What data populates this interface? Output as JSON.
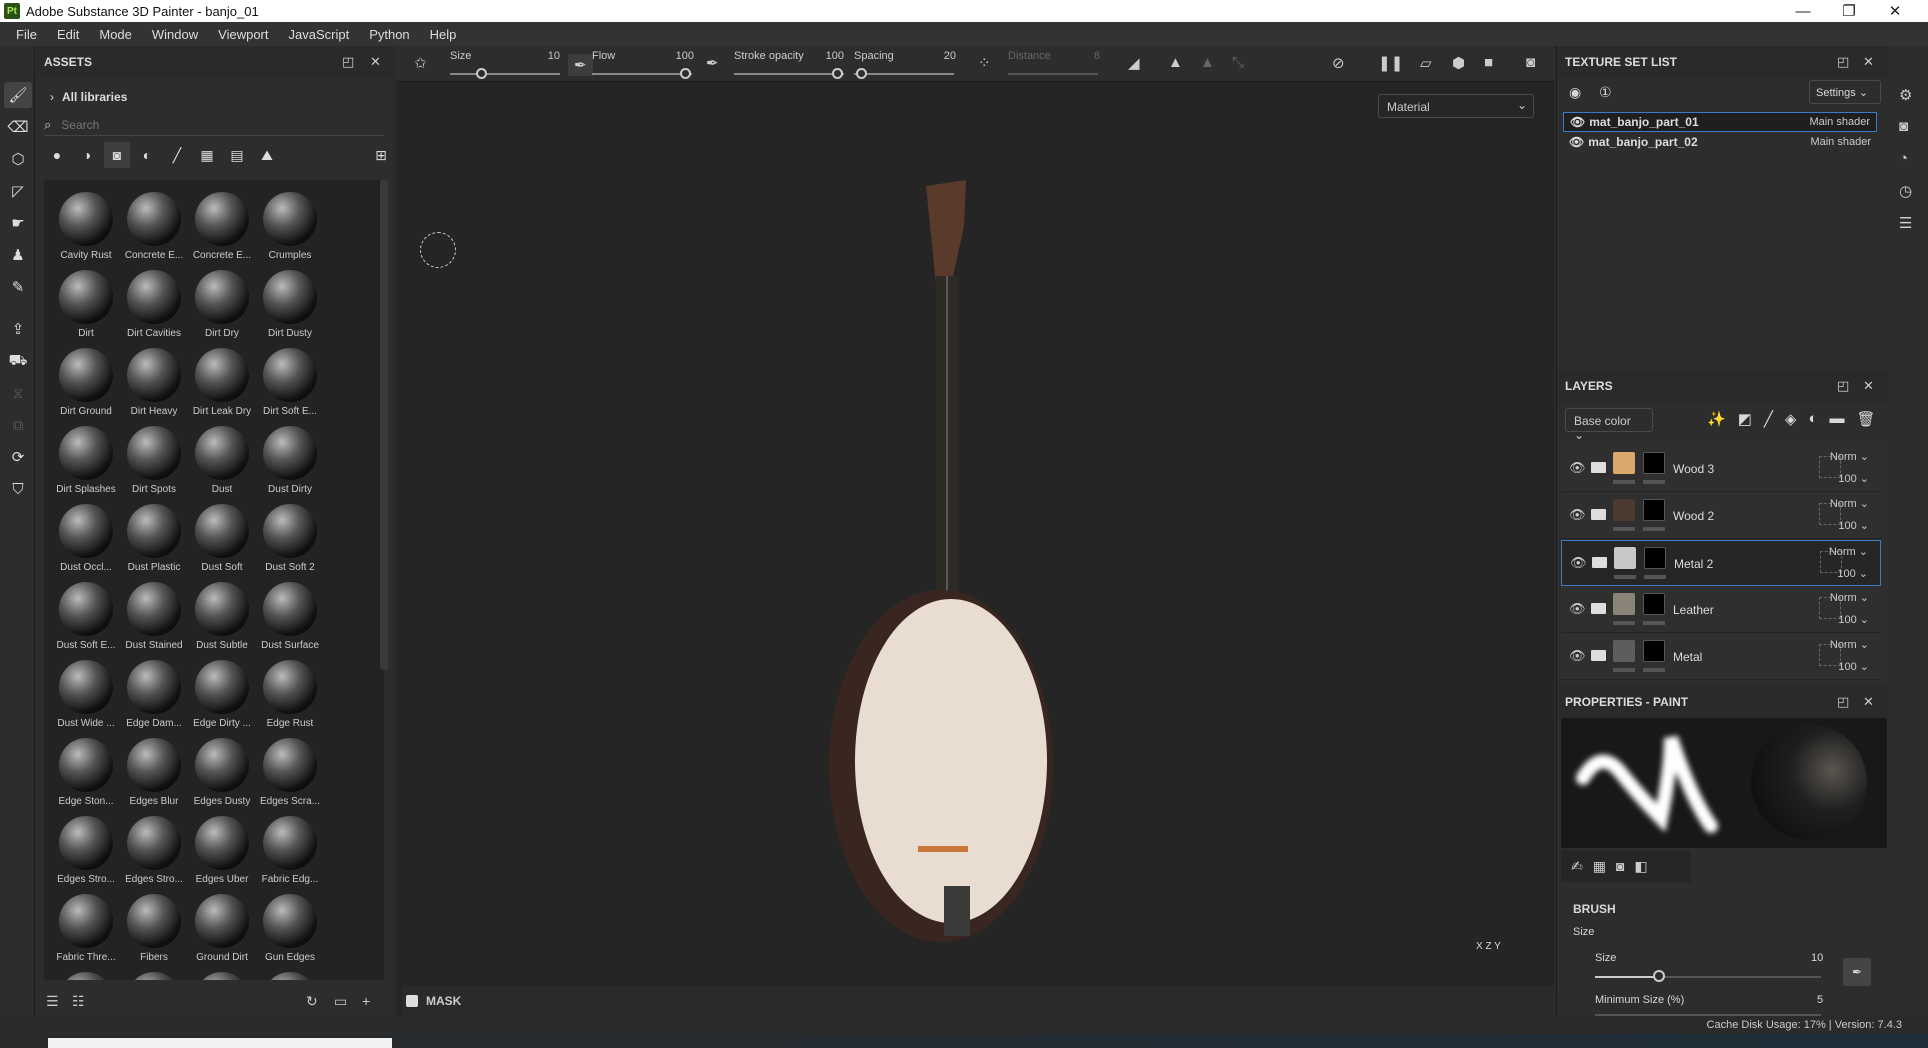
{
  "window": {
    "title": "Adobe Substance 3D Painter - banjo_01",
    "app_badge": "Pt",
    "minimize": "—",
    "restore": "❐",
    "close": "✕"
  },
  "menu": [
    "File",
    "Edit",
    "Mode",
    "Window",
    "Viewport",
    "JavaScript",
    "Python",
    "Help"
  ],
  "tools": [
    "paint-brush",
    "eraser",
    "projection",
    "polygon-fill",
    "smudge",
    "clone",
    "color-picker",
    "export",
    "bake",
    "timer",
    "transform",
    "sync",
    "shelf"
  ],
  "assets": {
    "title": "ASSETS",
    "library": "All libraries",
    "search_placeholder": "Search",
    "filters": [
      "materials",
      "smart-materials",
      "smart-masks",
      "filters",
      "brushes",
      "alphas",
      "textures",
      "environments"
    ],
    "items": [
      "Cavity Rust",
      "Concrete E...",
      "Concrete E...",
      "Crumples",
      "Dirt",
      "Dirt Cavities",
      "Dirt Dry",
      "Dirt Dusty",
      "Dirt Ground",
      "Dirt Heavy",
      "Dirt Leak Dry",
      "Dirt Soft E...",
      "Dirt Splashes",
      "Dirt Spots",
      "Dust",
      "Dust Dirty",
      "Dust Occl...",
      "Dust Plastic",
      "Dust Soft",
      "Dust Soft 2",
      "Dust Soft E...",
      "Dust Stained",
      "Dust Subtle",
      "Dust Surface",
      "Dust Wide ...",
      "Edge Dam...",
      "Edge Dirty ...",
      "Edge Rust",
      "Edge Ston...",
      "Edges Blur",
      "Edges Dusty",
      "Edges Scra...",
      "Edges Stro...",
      "Edges Stro...",
      "Edges Uber",
      "Fabric Edg...",
      "Fabric Thre...",
      "Fibers",
      "Ground Dirt",
      "Gun Edges",
      "",
      "",
      "",
      ""
    ]
  },
  "toolbar": {
    "size_label": "Size",
    "size_value": "10",
    "flow_label": "Flow",
    "flow_value": "100",
    "stroke_opacity_label": "Stroke opacity",
    "stroke_opacity_value": "100",
    "spacing_label": "Spacing",
    "spacing_value": "20",
    "distance_label": "Distance",
    "distance_value": "8"
  },
  "viewport": {
    "channel": "Material",
    "mask_label": "MASK",
    "gizmo": "X Z Y"
  },
  "texture_set_list": {
    "title": "TEXTURE SET LIST",
    "settings": "Settings",
    "sets": [
      {
        "name": "mat_banjo_part_01",
        "shader": "Main shader",
        "selected": true
      },
      {
        "name": "mat_banjo_part_02",
        "shader": "Main shader",
        "selected": false
      }
    ]
  },
  "layers": {
    "title": "LAYERS",
    "channel": "Base color",
    "items": [
      {
        "name": "Wood 3",
        "blend": "Norm",
        "opacity": "100",
        "color": "#d9a86a",
        "selected": false
      },
      {
        "name": "Wood 2",
        "blend": "Norm",
        "opacity": "100",
        "color": "#4a3a30",
        "selected": false
      },
      {
        "name": "Metal 2",
        "blend": "Norm",
        "opacity": "100",
        "color": "#c8c8c8",
        "selected": true
      },
      {
        "name": "Leather",
        "blend": "Norm",
        "opacity": "100",
        "color": "#8a8478",
        "selected": false
      },
      {
        "name": "Metal",
        "blend": "Norm",
        "opacity": "100",
        "color": "#5f5d5c",
        "selected": false
      }
    ]
  },
  "properties": {
    "title": "PROPERTIES - PAINT",
    "section": "BRUSH",
    "group": "Size",
    "size_label": "Size",
    "size_value": "10",
    "min_size_label": "Minimum Size (%)",
    "min_size_value": "5"
  },
  "status": {
    "text": "Cache Disk Usage:   17% | Version: 7.4.3"
  }
}
